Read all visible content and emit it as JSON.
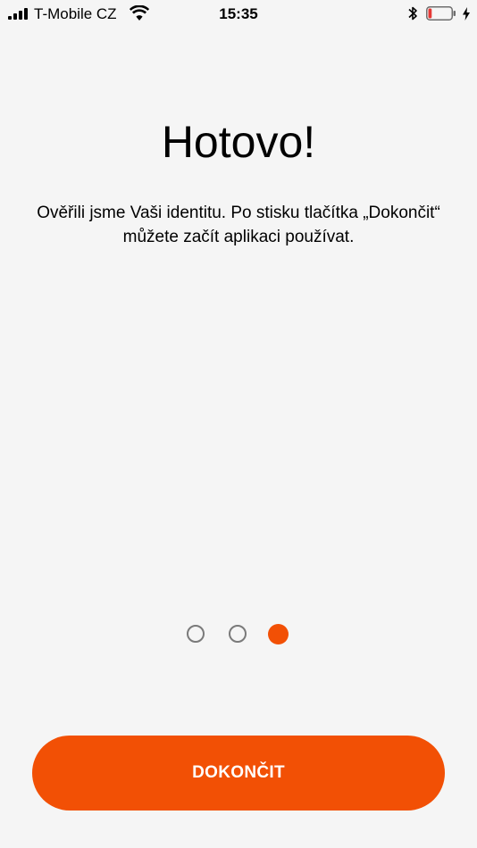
{
  "status_bar": {
    "carrier": "T-Mobile CZ",
    "time": "15:35",
    "battery_level": 0.15,
    "battery_color": "#e53935"
  },
  "screen": {
    "title": "Hotovo!",
    "message": "Ověřili jsme Vaši identitu. Po stisku tlačítka „Dokončit“ můžete začít aplikaci používat."
  },
  "pager": {
    "total_pages": 3,
    "current_page": 3
  },
  "finish_button": {
    "label": "DOKONČIT"
  },
  "colors": {
    "accent": "#f25005",
    "background": "#f5f5f5",
    "inactive_dot": "#7a7a7a"
  }
}
